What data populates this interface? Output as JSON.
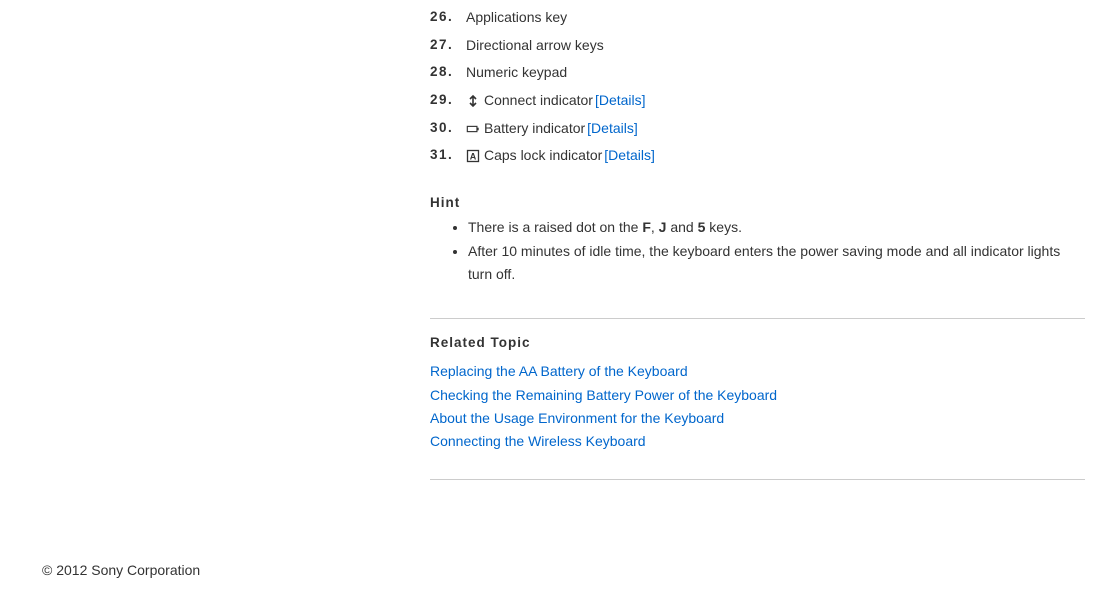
{
  "items": [
    {
      "num": "26.",
      "text": "Applications key"
    },
    {
      "num": "27.",
      "text": "Directional arrow keys"
    },
    {
      "num": "28.",
      "text": "Numeric keypad"
    },
    {
      "num": "29.",
      "icon": "connect",
      "text": "Connect indicator",
      "details": "[Details]"
    },
    {
      "num": "30.",
      "icon": "battery",
      "text": "Battery indicator",
      "details": "[Details]"
    },
    {
      "num": "31.",
      "icon": "capslock",
      "text": "Caps lock indicator",
      "details": "[Details]"
    }
  ],
  "hint": {
    "heading": "Hint",
    "bullets": [
      {
        "parts": [
          "There is a raised dot on the ",
          {
            "b": "F"
          },
          ", ",
          {
            "b": "J"
          },
          " and ",
          {
            "b": "5"
          },
          " keys."
        ]
      },
      {
        "parts": [
          "After 10 minutes of idle time, the keyboard enters the power saving mode and all indicator lights turn off."
        ]
      }
    ]
  },
  "related": {
    "heading": "Related Topic",
    "links": [
      "Replacing the AA Battery of the Keyboard",
      "Checking the Remaining Battery Power of the Keyboard",
      "About the Usage Environment for the Keyboard",
      "Connecting the Wireless Keyboard"
    ]
  },
  "copyright": "© 2012 Sony Corporation"
}
